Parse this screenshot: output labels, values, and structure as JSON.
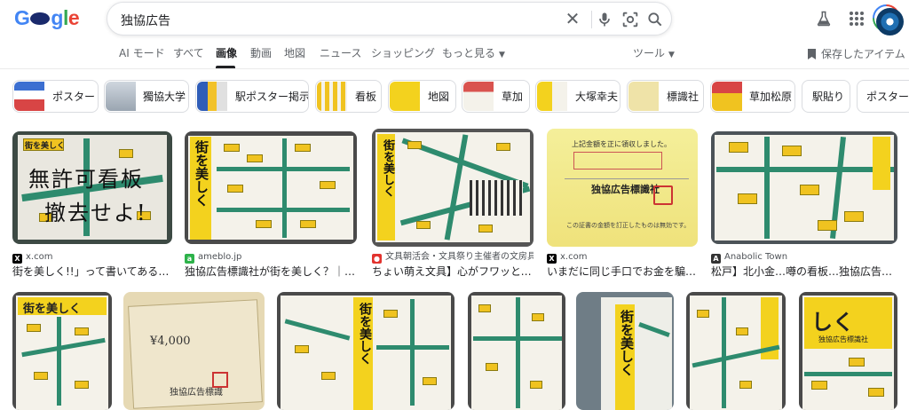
{
  "header": {
    "logo_text": "Google",
    "query": "独協広告",
    "icons": [
      "close-icon",
      "mic-icon",
      "lens-icon",
      "search-icon",
      "labs-icon",
      "apps-icon",
      "avatar"
    ]
  },
  "tabs": [
    {
      "label": "AI モード"
    },
    {
      "label": "すべて"
    },
    {
      "label": "画像"
    },
    {
      "label": "動画"
    },
    {
      "label": "地図"
    },
    {
      "label": "ニュース"
    },
    {
      "label": "ショッピング"
    },
    {
      "label": "もっと見る"
    },
    {
      "label": "ツール"
    }
  ],
  "saved_label": "保存したアイテム",
  "chips": [
    {
      "label": "ポスター"
    },
    {
      "label": "獨協大学"
    },
    {
      "label": "駅ポスター掲示"
    },
    {
      "label": "看板"
    },
    {
      "label": "地図"
    },
    {
      "label": "草加"
    },
    {
      "label": "大塚幸夫"
    },
    {
      "label": "標識社"
    },
    {
      "label": "草加松原"
    },
    {
      "label": "駅貼り"
    },
    {
      "label": "ポスター"
    }
  ],
  "results_row1": [
    {
      "source": "x.com",
      "caption": "街を美しく!!」って書いてあるのに…"
    },
    {
      "source": "ameblo.jp",
      "caption": "独協広告標識社が街を美しく？｜楽し…"
    },
    {
      "source": "文具朝活会・文具祭り主催者の文房具…",
      "caption": "ちょい萌え文具】心がフワッとな…"
    },
    {
      "source": "x.com",
      "caption": "いまだに同じ手口でお金を騙し…"
    },
    {
      "source": "Anabolic Town",
      "caption": "松戸】北小金…噂の看板…独協広告標識…"
    }
  ],
  "image_texts": {
    "img1_main": "無許可看板",
    "img1_sub": "撤去せよ!",
    "img1_top": "街を美しく",
    "img2_vertical": "街を美しく",
    "img3_vertical": "街を美しく",
    "img4_title": "独協広告標識社",
    "img4_line1": "上記金額を正に領収しました。",
    "img4_line2": "この証書の金額を訂正したものは無効です。",
    "img6_amount": "¥4,000",
    "img6_title": "独協広告標識",
    "img8_vertical": "街を美しく",
    "img10_vertical": "街を美しく",
    "img12_top": "しく",
    "img12_sub": "独協広告標識社"
  },
  "colors": {
    "accent": "#1a0dab",
    "road": "#2e8b6e",
    "note": "#f0c320",
    "board": "#f4f2ea"
  }
}
